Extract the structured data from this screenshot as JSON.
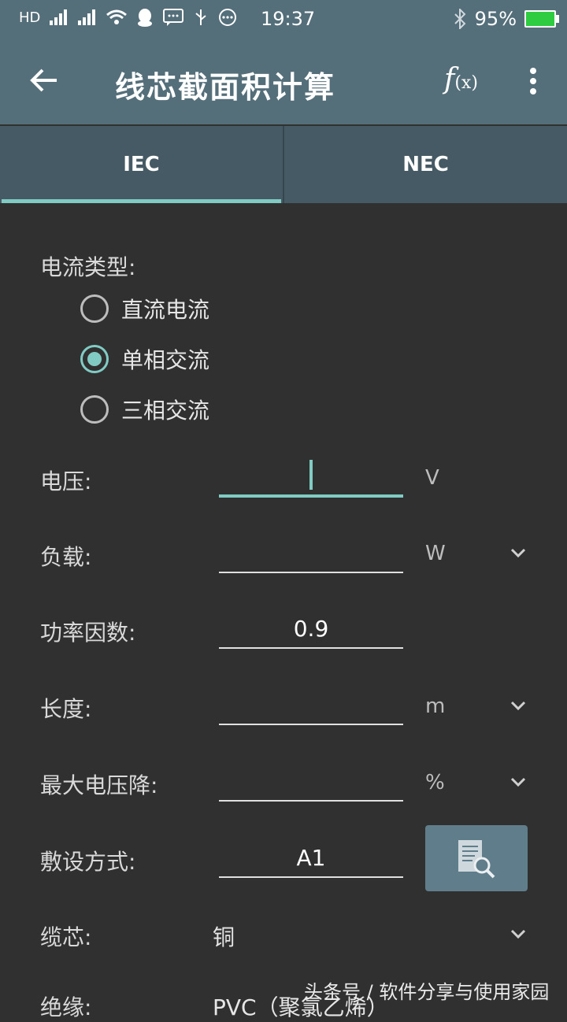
{
  "status_bar": {
    "left_icons": [
      "hd-icon",
      "signal-icon",
      "signal-icon",
      "wifi-icon",
      "qq-icon",
      "message-icon",
      "usb-icon",
      "more-circle-icon"
    ],
    "time": "19:37",
    "battery": "95%"
  },
  "appbar": {
    "title": "线芯截面积计算"
  },
  "tabs": [
    {
      "label": "IEC",
      "active": true
    },
    {
      "label": "NEC",
      "active": false
    }
  ],
  "current_type": {
    "label": "电流类型:",
    "options": [
      {
        "label": "直流电流",
        "checked": false
      },
      {
        "label": "单相交流",
        "checked": true
      },
      {
        "label": "三相交流",
        "checked": false
      }
    ]
  },
  "fields": {
    "voltage": {
      "label": "电压:",
      "value": "",
      "unit": "V"
    },
    "load": {
      "label": "负载:",
      "value": "",
      "unit": "W"
    },
    "power_factor": {
      "label": "功率因数:",
      "value": "0.9"
    },
    "length": {
      "label": "长度:",
      "value": "",
      "unit": "m"
    },
    "max_drop": {
      "label": "最大电压降:",
      "value": "",
      "unit": "%"
    },
    "install_method": {
      "label": "敷设方式:",
      "value": "A1"
    },
    "core": {
      "label": "缆芯:",
      "value": "铜"
    },
    "insulation": {
      "label": "绝缘:",
      "value": "PVC（聚氯乙烯）"
    }
  },
  "watermark": "头条号 / 软件分享与使用家园",
  "colors": {
    "accent": "#80cbc4",
    "appbar": "#546e7a",
    "tab": "#455a64",
    "background": "#303030"
  }
}
